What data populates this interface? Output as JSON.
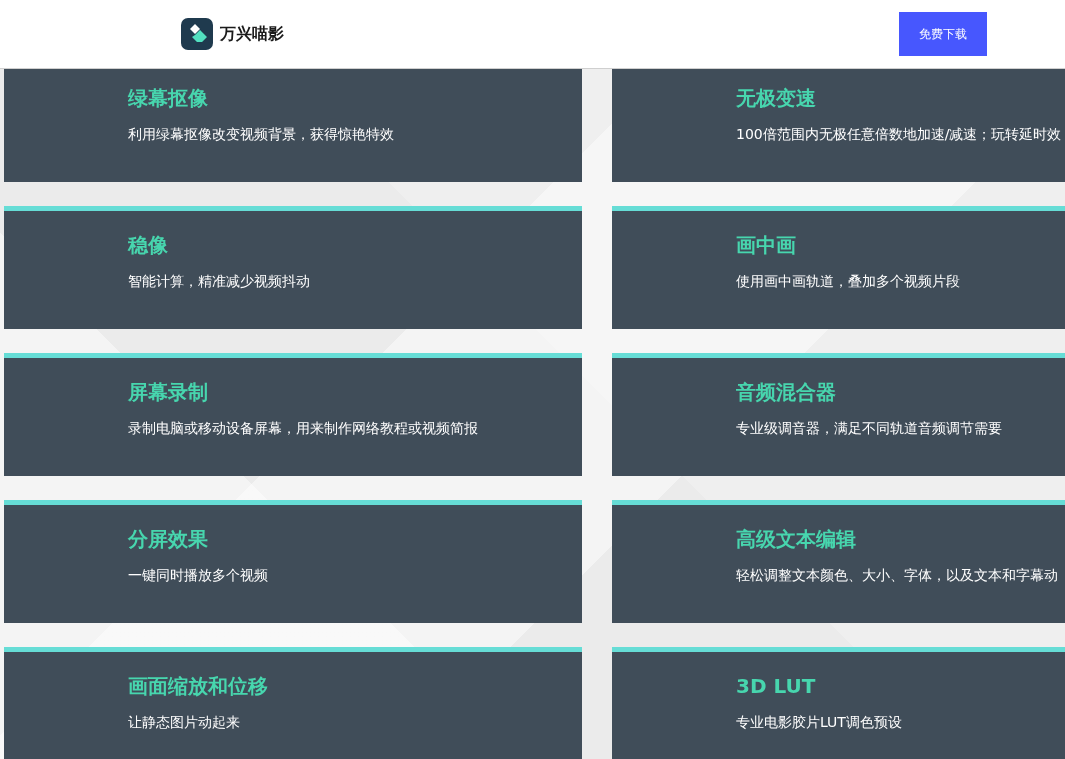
{
  "header": {
    "brand": "万兴喵影",
    "download_button": "免费下载"
  },
  "features": [
    {
      "title": "绿幕抠像",
      "description": "利用绿幕抠像改变视频背景，获得惊艳特效"
    },
    {
      "title": "无极变速",
      "description": "100倍范围内无极任意倍数地加速/减速；玩转延时效"
    },
    {
      "title": "稳像",
      "description": "智能计算，精准减少视频抖动"
    },
    {
      "title": "画中画",
      "description": "使用画中画轨道，叠加多个视频片段"
    },
    {
      "title": "屏幕录制",
      "description": "录制电脑或移动设备屏幕，用来制作网络教程或视频简报"
    },
    {
      "title": "音频混合器",
      "description": "专业级调音器，满足不同轨道音频调节需要"
    },
    {
      "title": "分屏效果",
      "description": "一键同时播放多个视频"
    },
    {
      "title": "高级文本编辑",
      "description": "轻松调整文本颜色、大小、字体，以及文本和字幕动"
    },
    {
      "title": "画面缩放和位移",
      "description": "让静态图片动起来"
    },
    {
      "title": "3D LUT",
      "description": "专业电影胶片LUT调色预设"
    }
  ]
}
